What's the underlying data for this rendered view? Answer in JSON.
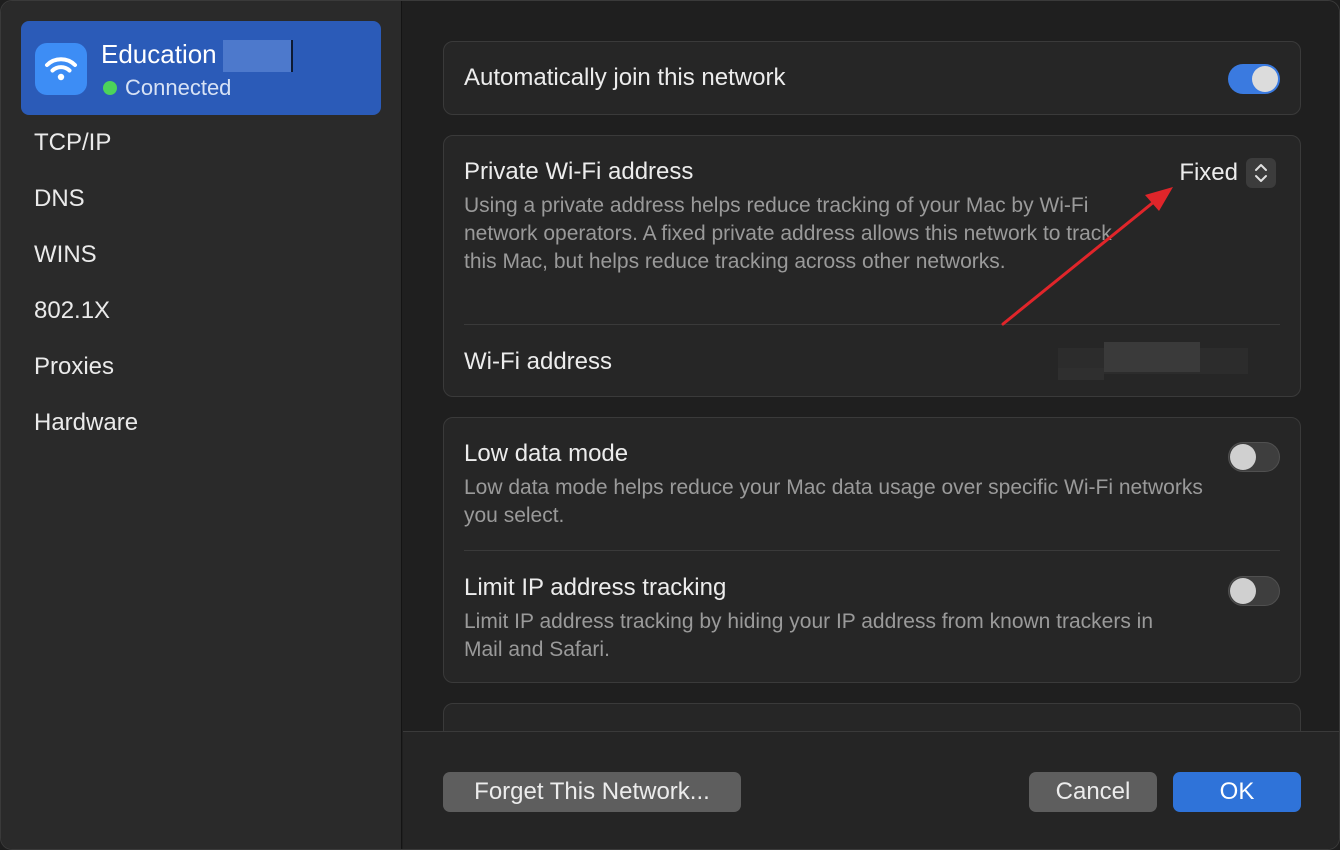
{
  "sidebar": {
    "network": {
      "name": "Education",
      "status": "Connected",
      "status_color": "#4cd35a"
    },
    "items": [
      {
        "label": "TCP/IP"
      },
      {
        "label": "DNS"
      },
      {
        "label": "WINS"
      },
      {
        "label": "802.1X"
      },
      {
        "label": "Proxies"
      },
      {
        "label": "Hardware"
      }
    ]
  },
  "main": {
    "auto_join": {
      "label": "Automatically join this network",
      "enabled": true
    },
    "private_address": {
      "label": "Private Wi-Fi address",
      "value": "Fixed",
      "description": "Using a private address helps reduce tracking of your Mac by Wi-Fi network operators. A fixed private address allows this network to track this Mac, but helps reduce tracking across other networks."
    },
    "wifi_address": {
      "label": "Wi-Fi address"
    },
    "low_data_mode": {
      "label": "Low data mode",
      "enabled": false,
      "description": "Low data mode helps reduce your Mac data usage over specific Wi-Fi networks you select."
    },
    "limit_ip_tracking": {
      "label": "Limit IP address tracking",
      "enabled": false,
      "description": "Limit IP address tracking by hiding your IP address from known trackers in Mail and Safari."
    }
  },
  "footer": {
    "forget_label": "Forget This Network...",
    "cancel_label": "Cancel",
    "ok_label": "OK"
  },
  "colors": {
    "accent": "#2f73d9",
    "toggle_on": "#3a7ae0",
    "annotation_arrow": "#e0252a"
  }
}
